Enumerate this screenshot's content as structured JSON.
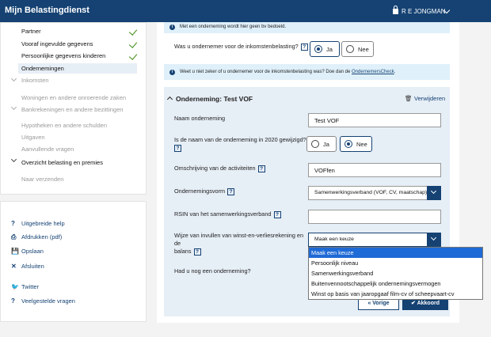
{
  "header": {
    "title": "Mijn Belastingdienst",
    "user": "R E JONGMAN"
  },
  "sidebar": {
    "items": [
      {
        "label": "Partner",
        "done": true
      },
      {
        "label": "Vooraf ingevulde gegevens",
        "done": true
      },
      {
        "label": "Persoonlijke gegevens kinderen",
        "done": true
      },
      {
        "label": "Ondernemingen"
      },
      {
        "label": "Inkomsten"
      },
      {
        "label": "Woningen en andere onroerende zaken"
      },
      {
        "label": "Bankrekeningen en andere bezittingen"
      },
      {
        "label": "Hypotheken en andere schulden"
      },
      {
        "label": "Uitgaven"
      },
      {
        "label": "Aanvullende vragen"
      },
      {
        "label": "Overzicht belasting en premies"
      },
      {
        "label": "Naar verzenden"
      }
    ],
    "actions": [
      {
        "icon": "?",
        "label": "Uitgebreide help"
      },
      {
        "icon": "⎙",
        "label": "Afdrukken (pdf)"
      },
      {
        "icon": "💾",
        "label": "Opslaan"
      },
      {
        "icon": "✕",
        "label": "Afsluiten"
      },
      {
        "icon": "🐦",
        "label": "Twitter"
      },
      {
        "icon": "?",
        "label": "Veelgestelde vragen"
      }
    ]
  },
  "main": {
    "top_note": "Met een onderneming wordt hier geen bv bedoeld.",
    "q_ondernemer": "Was u ondernemer voor de inkomstenbelasting?",
    "ja": "Ja",
    "nee": "Nee",
    "info_text": "Weet u niet zeker of u ondernemer voor de inkomstenbelasting was? Doe dan de ",
    "info_link": "OndernemersCheck",
    "section_title": "Onderneming: Test VOF",
    "remove_label": "Verwijderen",
    "fields": {
      "naam_label": "Naam onderneming",
      "naam_value": "Test VOF",
      "gewijzigd_label": "Is de naam van de onderneming in 2020 gewijzigd?",
      "omschrijving_label": "Omschrijving van de activiteiten",
      "omschrijving_value": "VOFfen",
      "vorm_label": "Ondernemingsvorm",
      "vorm_value": "Samenwerkingsverband (VOF, CV, maatschap)",
      "rsin_label": "RSIN van het samenwerkingsverband",
      "rsin_value": "",
      "wijze_label_1": "Wijze van invullen van winst-en-verliesrekening en de",
      "wijze_label_2": "balans",
      "wijze_value": "Maak een keuze"
    },
    "dropdown_options": [
      "Maak een keuze",
      "Persoonlijk niveau",
      "Samenwerkingsverband",
      "Buitenvennootschappelijk ondernemingsvermogen",
      "Winst op basis van jaaropgaaf film-cv of scheepvaart-cv"
    ],
    "nog_label": "Had u nog een onderneming?",
    "prev_label": "Vorige",
    "next_label": "Akkoord"
  }
}
